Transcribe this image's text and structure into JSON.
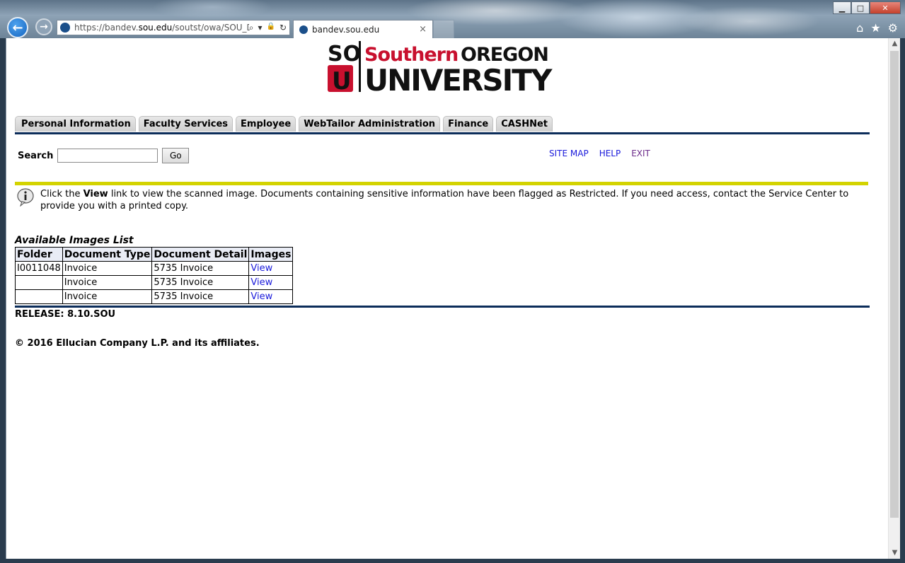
{
  "browser": {
    "url_prefix": "https://bandev.",
    "url_host": "sou.edu",
    "url_path": "/soutst/owa/SOU_Dc",
    "tab_title": "bandev.sou.edu",
    "back_glyph": "←",
    "forward_glyph": "→",
    "minimize_glyph": "▁",
    "maximize_glyph": "□",
    "close_glyph": "✕",
    "search_glyph": "⌕",
    "dropdown_glyph": "▾",
    "lock_glyph": "🔒",
    "refresh_glyph": "↻",
    "tab_close_glyph": "×",
    "home_glyph": "⌂",
    "favorites_glyph": "★",
    "tools_glyph": "⚙"
  },
  "logo": {
    "mono_top": "SO",
    "mono_bottom": "U",
    "word_southern": "Southern",
    "word_oregon": "OREGON",
    "word_university": "UNIVERSITY"
  },
  "nav_tabs": [
    {
      "label": "Personal Information"
    },
    {
      "label": "Faculty Services"
    },
    {
      "label": "Employee"
    },
    {
      "label": "WebTailor Administration"
    },
    {
      "label": "Finance"
    },
    {
      "label": "CASHNet"
    }
  ],
  "search": {
    "label": "Search",
    "value": "",
    "button": "Go"
  },
  "links": {
    "site_map": "SITE MAP",
    "help": "HELP",
    "exit": "EXIT"
  },
  "info": {
    "pre": "Click the ",
    "bold": "View",
    "post": " link to view the scanned image. Documents containing sensitive information have been flagged as Restricted. If you need access, contact the Service Center to provide you with a printed copy."
  },
  "images_list": {
    "title": "Available Images List",
    "headers": [
      "Folder",
      "Document Type",
      "Document Detail",
      "Images"
    ],
    "rows": [
      {
        "folder": "I0011048",
        "type": "Invoice",
        "detail": "5735 Invoice",
        "link": "View"
      },
      {
        "folder": "",
        "type": "Invoice",
        "detail": "5735 Invoice",
        "link": "View"
      },
      {
        "folder": "",
        "type": "Invoice",
        "detail": "5735 Invoice",
        "link": "View"
      }
    ]
  },
  "footer": {
    "release": "RELEASE: 8.10.SOU",
    "copyright": "© 2016 Ellucian Company L.P. and its affiliates."
  },
  "colors": {
    "sou_red": "#c8102e",
    "navy_rule": "#0c2d5a",
    "yellow_rule": "#d3d300",
    "link_blue": "#1a1adb"
  },
  "scrollbar": {
    "up_glyph": "▲",
    "down_glyph": "▼"
  }
}
